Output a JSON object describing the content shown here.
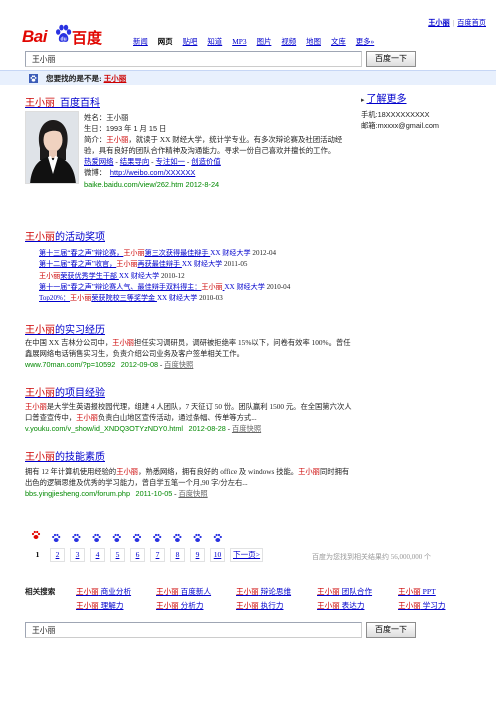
{
  "top": {
    "user": "王小丽",
    "sep": "|",
    "home": "百度首页"
  },
  "logo": {
    "left": "Bai",
    "right": "百度"
  },
  "nav": [
    "新闻",
    "网页",
    "贴吧",
    "知道",
    "MP3",
    "图片",
    "视频",
    "地图",
    "文库",
    "更多»"
  ],
  "nav_active_index": 1,
  "search": {
    "value": "王小丽",
    "button": "百度一下"
  },
  "tip": {
    "prefix": "您要找的是不是: ",
    "name": "王小丽"
  },
  "baike": {
    "title_name": "王小丽",
    "title_suffix": "_百度百科",
    "name_line": {
      "label": "姓名：",
      "value": "王小丽"
    },
    "birth_line": "生日：1993 年 1 月 15 日",
    "intro_label": "简介：",
    "intro_em": "王小丽",
    "intro_text": "，就读于 XX 财经大学，统计学专业。有多次辩论赛及社团活动经验，具有良好的团队合作精神及沟通能力。寻求一份自己喜欢并擅长的工作。",
    "links": [
      "热爱网络",
      "结果导向",
      "专注如一",
      "创造价值"
    ],
    "weibo_label": "微博：",
    "weibo_url": "http://weibo.com/XXXXXX",
    "url": "baike.baidu.com/view/262.htm 2012-8-24"
  },
  "right": {
    "more": "了解更多",
    "phone": "手机:18XXXXXXXXX",
    "email": "邮箱:mxxxx@gmail.com"
  },
  "awards": {
    "title_em": "王小丽",
    "title_suffix": "的活动奖项",
    "rows": [
      {
        "pre": "第十三届“春之声”辩论赛，",
        "em": "王小丽",
        "post": "第三次获得最佳辩手 ",
        "tail": "XX 财经大学",
        "date": " 2012-04"
      },
      {
        "pre": "第十二届“春之声”收官，",
        "em": "王小丽",
        "post": "再获最佳辩手 ",
        "tail": "XX 财经大学",
        "date": " 2011-05"
      },
      {
        "pre": "",
        "em": "王小丽",
        "post": "荣获优秀学生干部 ",
        "tail": "XX 财经大学",
        "date": " 2010-12"
      },
      {
        "pre": "第十一届“春之声”辩论赛人气、最佳辩手双料得主：",
        "em": "王小丽",
        "post": " ",
        "tail": "XX 财经大学",
        "date": " 2010-04"
      },
      {
        "pre": "Top20%：",
        "em": "王小丽",
        "post": "荣获院校三等奖学金 ",
        "tail": "XX 财经大学",
        "date": " 2010-03"
      }
    ]
  },
  "intern": {
    "title_em": "王小丽",
    "title_suffix": "的实习经历",
    "text_pre": "在中国 XX 吉林分公司中，",
    "text_em": "王小丽",
    "text_post": "担任实习调研员，调研被拒绝率 15%以下，问卷有效率 100%。曾任鑫展网络电话销售实习生，负责介绍公司业务及客户签单相关工作。",
    "url": "www.70man.com/?p=10592",
    "date": "2012-09-08",
    "snap": "百度快照"
  },
  "project": {
    "title_em": "王小丽",
    "title_suffix": "的项目经验",
    "text_em1": "王小丽",
    "text_a": "是大学生英语报校园代理，组建 4 人团队，7 天征订 50 份。团队赢利 1500 元。在全国第六次人口普查宣传中，",
    "text_em2": "王小丽",
    "text_b": "负责白山地区宣传活动，通过条幅、传单等方式...",
    "url": "v.youku.com/v_show/id_XNDQ3OTYzNDY0.html",
    "date": "2012-08-28",
    "snap": "百度快照"
  },
  "skills": {
    "title_em": "王小丽",
    "title_suffix": "的技能素质",
    "text_a": "拥有 12 年计算机使用经验的",
    "text_em1": "王小丽",
    "text_b": "，熟悉网络，拥有良好的 office 及 windows 技能。",
    "text_em2": "王小丽",
    "text_c": "同时拥有出色的逻辑思维及优秀的学习能力，曾自学五笔一个月,90 字/分左右...",
    "url": "bbs.yingjiesheng.com/forum.php",
    "date": "2011-10-05",
    "snap": "百度快照"
  },
  "pager": {
    "pages": [
      "1",
      "2",
      "3",
      "4",
      "5",
      "6",
      "7",
      "8",
      "9",
      "10"
    ],
    "current": "1",
    "next": "下一页>"
  },
  "total": "百度为您找到相关结果约 56,000,000 个",
  "related": {
    "label": "相关搜索",
    "items": [
      {
        "em": "王小丽",
        "post": " 商业分析"
      },
      {
        "em": "王小丽",
        "post": " 百度新人"
      },
      {
        "em": "王小丽",
        "post": " 辩论思维"
      },
      {
        "em": "王小丽",
        "post": " 团队合作"
      },
      {
        "em": "王小丽",
        "post": " PPT"
      },
      {
        "em": "王小丽",
        "post": " 理解力"
      },
      {
        "em": "王小丽",
        "post": " 分析力"
      },
      {
        "em": "王小丽",
        "post": " 执行力"
      },
      {
        "em": "王小丽",
        "post": " 表达力"
      },
      {
        "em": "王小丽",
        "post": " 学习力"
      }
    ]
  },
  "bottom_search": {
    "value": "王小丽",
    "button": "百度一下"
  },
  "colors": {
    "link": "#0000cc",
    "highlight": "#cc0000",
    "url": "#008000",
    "logo": "#e10601",
    "tip_bg": "#e8f0fd"
  }
}
